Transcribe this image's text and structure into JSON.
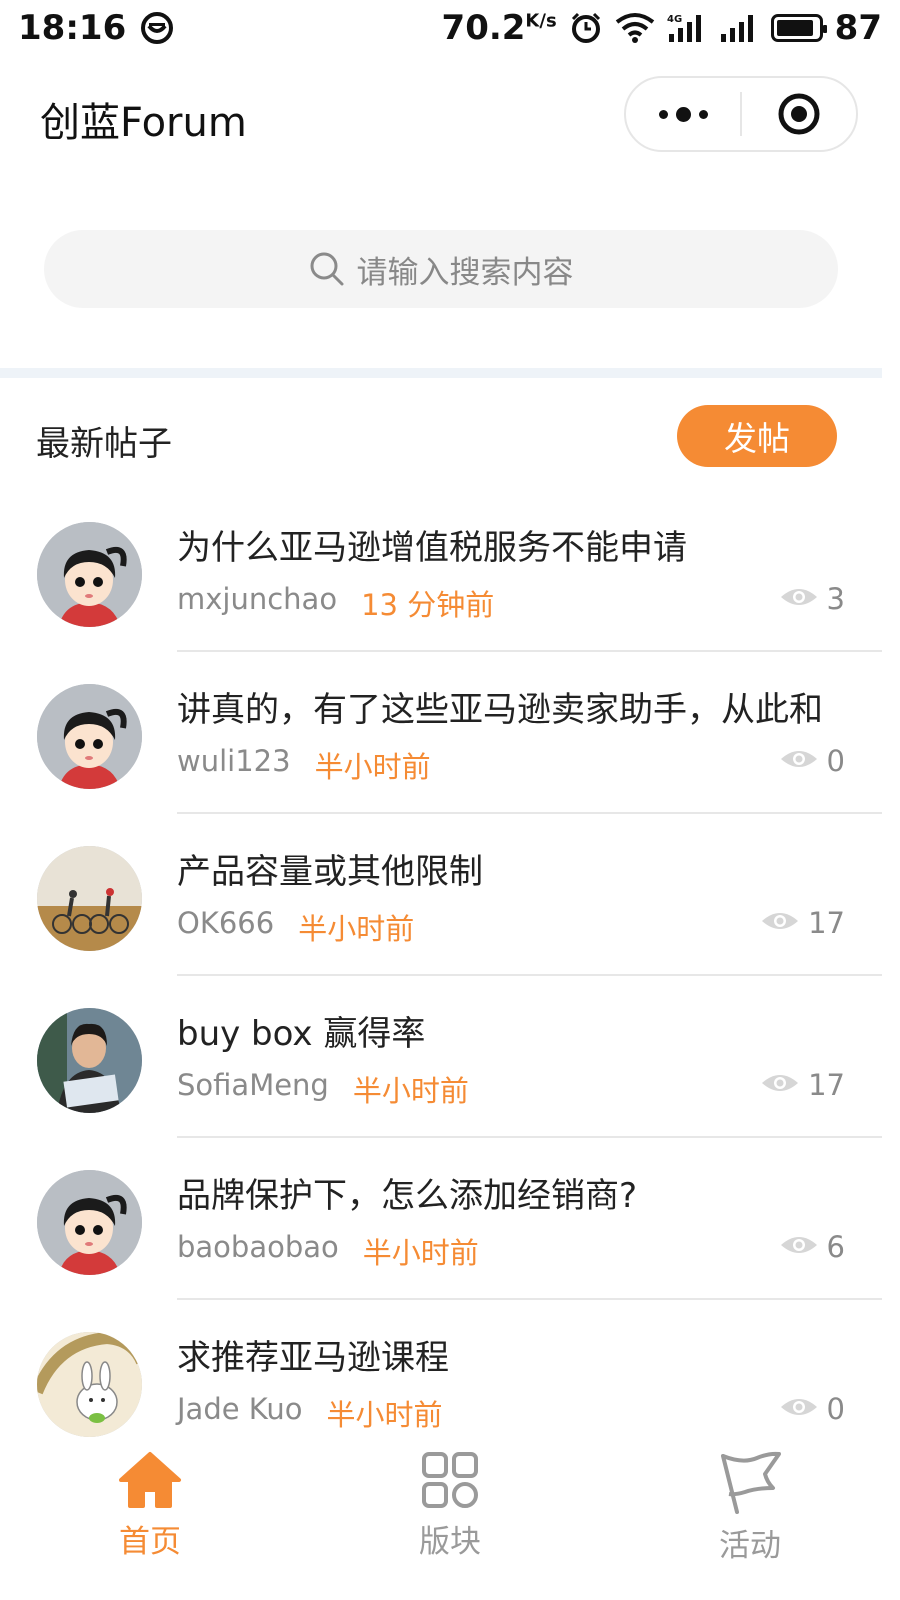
{
  "status_bar": {
    "time": "18:16",
    "speed": "70.2",
    "speed_unit": "K/s",
    "battery": "87",
    "battery_level": 0.87
  },
  "header": {
    "title": "创蓝Forum"
  },
  "search": {
    "placeholder": "请输入搜索内容"
  },
  "posts_section": {
    "title": "最新帖子",
    "new_post_label": "发帖"
  },
  "posts": [
    {
      "title": "为什么亚马逊增值税服务不能申请",
      "author": "mxjunchao",
      "time": "13 分钟前",
      "views": "3",
      "avatar": "cartoon-girl"
    },
    {
      "title": "讲真的，有了这些亚马逊卖家助手，从此和",
      "author": "wuli123",
      "time": "半小时前",
      "views": "0",
      "avatar": "cartoon-girl"
    },
    {
      "title": "产品容量或其他限制",
      "author": "OK666",
      "time": "半小时前",
      "views": "17",
      "avatar": "cyclists-photo"
    },
    {
      "title": "buy box 赢得率",
      "author": "SofiaMeng",
      "time": "半小时前",
      "views": "17",
      "avatar": "woman-photo"
    },
    {
      "title": "品牌保护下，怎么添加经销商?",
      "author": "baobaobao",
      "time": "半小时前",
      "views": "6",
      "avatar": "cartoon-girl"
    },
    {
      "title": "求推荐亚马逊课程",
      "author": "Jade Kuo",
      "time": "半小时前",
      "views": "0",
      "avatar": "bunny-cartoon"
    }
  ],
  "tab_bar": {
    "tabs": [
      {
        "label": "首页",
        "icon": "home-icon",
        "active": true
      },
      {
        "label": "版块",
        "icon": "grid-icon",
        "active": false
      },
      {
        "label": "活动",
        "icon": "flag-icon",
        "active": false
      }
    ]
  },
  "colors": {
    "accent": "#f58b34",
    "muted_text": "#8a8a8a",
    "search_bg": "#f4f4f4",
    "divider": "#eef3f8"
  }
}
